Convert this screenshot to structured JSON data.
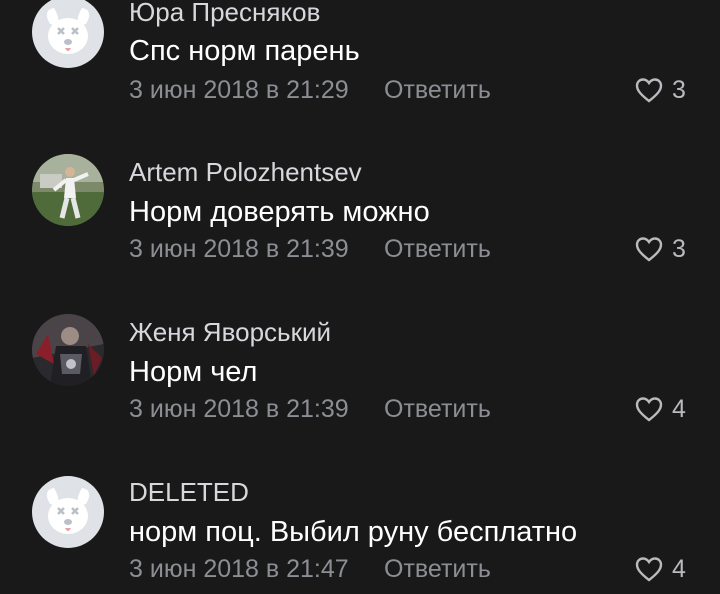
{
  "comments": [
    {
      "author": "Юра Пресняков",
      "text": "Спс норм парень",
      "date": "3 июн 2018 в 21:29",
      "reply_label": "Ответить",
      "likes": "3",
      "avatar": "deleted-dog-icon"
    },
    {
      "author": "Artem Polozhentsev",
      "text": "Норм доверять можно",
      "date": "3 июн 2018 в 21:39",
      "reply_label": "Ответить",
      "likes": "3",
      "avatar": "user-photo"
    },
    {
      "author": "Женя Яворський",
      "text": "Норм чел",
      "date": "3 июн 2018 в 21:39",
      "reply_label": "Ответить",
      "likes": "4",
      "avatar": "user-photo"
    },
    {
      "author": "DELETED",
      "text": "норм поц. Выбил руну бесплатно",
      "date": "3 июн 2018 в 21:47",
      "reply_label": "Ответить",
      "likes": "4",
      "avatar": "deleted-dog-icon"
    }
  ],
  "colors": {
    "background": "#19191a",
    "author": "#d7d8db",
    "text": "#ffffff",
    "meta": "#8b8e93",
    "deleted_avatar_bg": "#dfe3e8"
  }
}
